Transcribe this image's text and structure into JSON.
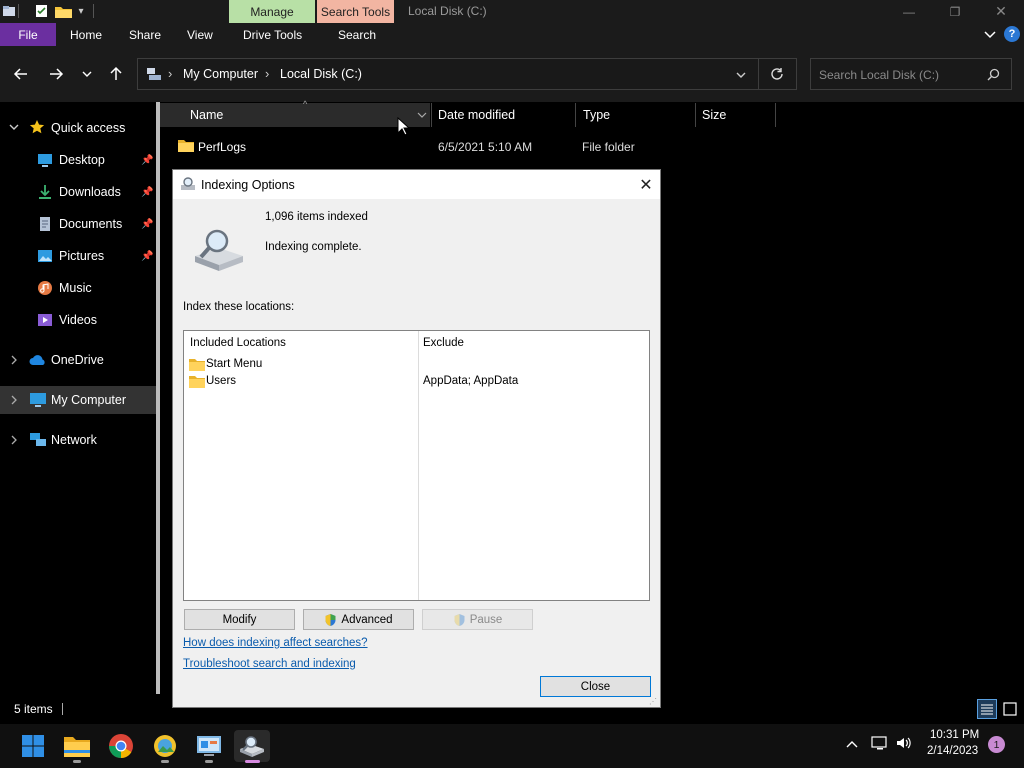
{
  "window": {
    "title": "Local Disk (C:)",
    "minimize_glyph": "—",
    "maximize_glyph": "❐",
    "close_glyph": "✕"
  },
  "context_tabs": {
    "manage": "Manage",
    "search_tools": "Search Tools",
    "manage_color": "#b8e0a6",
    "search_tools_color": "#f2b5a2"
  },
  "ribbon": {
    "tabs": [
      "File",
      "Home",
      "Share",
      "View",
      "Drive Tools",
      "Search"
    ],
    "file_color": "#6b2fa0"
  },
  "address": {
    "breadcrumb": [
      "My Computer",
      "Local Disk (C:)"
    ],
    "separator": "›"
  },
  "search": {
    "placeholder": "Search Local Disk (C:)"
  },
  "nav": {
    "quick_access": "Quick access",
    "items": [
      {
        "label": "Desktop",
        "icon": "desktop-icon",
        "pinned": true
      },
      {
        "label": "Downloads",
        "icon": "downloads-icon",
        "pinned": true
      },
      {
        "label": "Documents",
        "icon": "documents-icon",
        "pinned": true
      },
      {
        "label": "Pictures",
        "icon": "pictures-icon",
        "pinned": true
      },
      {
        "label": "Music",
        "icon": "music-icon",
        "pinned": false
      },
      {
        "label": "Videos",
        "icon": "videos-icon",
        "pinned": false
      }
    ],
    "onedrive": "OneDrive",
    "my_computer": "My Computer",
    "network": "Network"
  },
  "columns": {
    "name": "Name",
    "date_modified": "Date modified",
    "type": "Type",
    "size": "Size"
  },
  "files": [
    {
      "name": "PerfLogs",
      "date_modified": "6/5/2021 5:10 AM",
      "type": "File folder",
      "size": ""
    }
  ],
  "status": {
    "item_count": "5 items"
  },
  "dialog": {
    "title": "Indexing Options",
    "items_indexed": "1,096 items indexed",
    "status": "Indexing complete.",
    "locations_label": "Index these locations:",
    "col_included": "Included Locations",
    "col_exclude": "Exclude",
    "locations": [
      {
        "name": "Start Menu",
        "exclude": ""
      },
      {
        "name": "Users",
        "exclude": "AppData; AppData"
      }
    ],
    "buttons": {
      "modify": "Modify",
      "advanced": "Advanced",
      "pause": "Pause",
      "close": "Close"
    },
    "links": {
      "how": "How does indexing affect searches?",
      "troubleshoot": "Troubleshoot search and indexing"
    }
  },
  "taskbar": {
    "time": "10:31 PM",
    "date": "2/14/2023",
    "notification_count": "1",
    "apps": [
      "start-icon",
      "file-explorer-icon",
      "chrome-icon",
      "photos-icon",
      "control-panel-icon",
      "indexing-options-icon"
    ]
  }
}
